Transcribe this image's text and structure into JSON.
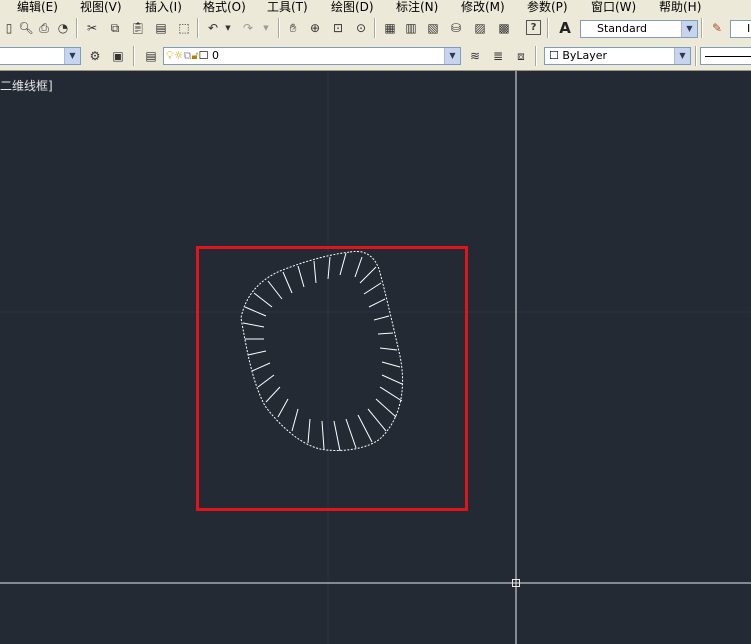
{
  "menubar": {
    "items": [
      "编辑(E)",
      "视图(V)",
      "插入(I)",
      "格式(O)",
      "工具(T)",
      "绘图(D)",
      "标注(N)",
      "修改(M)",
      "参数(P)",
      "窗口(W)",
      "帮助(H)"
    ]
  },
  "toolbar": {
    "text_style": "Standard",
    "text_style_next": "I",
    "layer_value": "0",
    "color_value": "ByLayer"
  },
  "viewport": {
    "label": "二维线框]"
  },
  "colors": {
    "canvas_bg": "#232a34",
    "highlight_box": "#e0151b",
    "shape_stroke": "#ffffff",
    "crosshair": "#ffffff"
  },
  "icons": {
    "menu_icons": [],
    "toolbar_row1": [
      "open-icon",
      "plot-icon",
      "publish-icon",
      "cut-icon",
      "copy-icon",
      "paste-icon",
      "match-properties-icon",
      "block-editor-icon",
      "undo-icon",
      "redo-icon",
      "pan-icon",
      "zoom-realtime-icon",
      "zoom-window-icon",
      "zoom-previous-icon",
      "properties-icon",
      "design-center-icon",
      "tool-palettes-icon",
      "sheet-set-icon",
      "markup-icon",
      "calculator-icon",
      "help-icon",
      "text-style-icon",
      "dim-style-icon"
    ],
    "toolbar_row2": [
      "workspace-settings-icon",
      "lock-ui-icon",
      "layer-properties-icon",
      "layer-on-icon",
      "layer-freeze-icon",
      "layer-vp-freeze-icon",
      "layer-lock-icon",
      "color-swatch-icon",
      "make-current-icon",
      "layer-previous-icon",
      "layer-states-icon"
    ]
  }
}
